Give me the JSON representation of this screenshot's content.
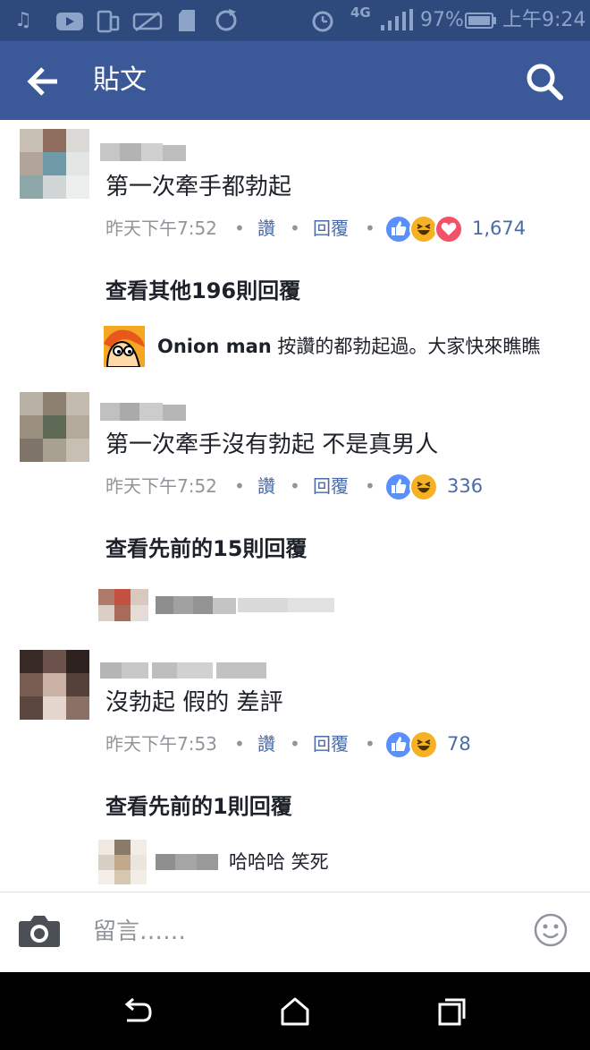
{
  "status_bar": {
    "battery_percent": "97%",
    "time": "上午9:24",
    "network": "4G"
  },
  "header": {
    "title": "貼文",
    "back_icon": "arrow-left-icon",
    "search_icon": "search-icon"
  },
  "comments": [
    {
      "text": "第一次牽手都勃起",
      "time": "昨天下午7:52",
      "like_label": "讚",
      "reply_label": "回覆",
      "separator": "•",
      "reaction_count": "1,674",
      "reactions": [
        "like",
        "haha",
        "love"
      ],
      "more_replies": "查看其他196則回覆",
      "reply": {
        "author": "Onion man",
        "text": "按讚的都勃起過。大家快來瞧瞧"
      }
    },
    {
      "text": "第一次牽手沒有勃起 不是真男人",
      "time": "昨天下午7:52",
      "like_label": "讚",
      "reply_label": "回覆",
      "separator": "•",
      "reaction_count": "336",
      "reactions": [
        "like",
        "haha"
      ],
      "more_replies": "查看先前的15則回覆"
    },
    {
      "text": "沒勃起 假的 差評",
      "time": "昨天下午7:53",
      "like_label": "讚",
      "reply_label": "回覆",
      "separator": "•",
      "reaction_count": "78",
      "reactions": [
        "like",
        "haha"
      ],
      "more_replies": "查看先前的1則回覆",
      "reply": {
        "text": "哈哈哈 笑死"
      }
    }
  ],
  "composer": {
    "placeholder": "留言……",
    "camera_icon": "camera-icon",
    "emoji_icon": "smiley-icon"
  },
  "colors": {
    "brand": "#3b5998",
    "status_bar": "#2e4a7d",
    "link": "#4b6aa6",
    "like": "#5890ff",
    "haha": "#f7b125",
    "love": "#f25268"
  }
}
